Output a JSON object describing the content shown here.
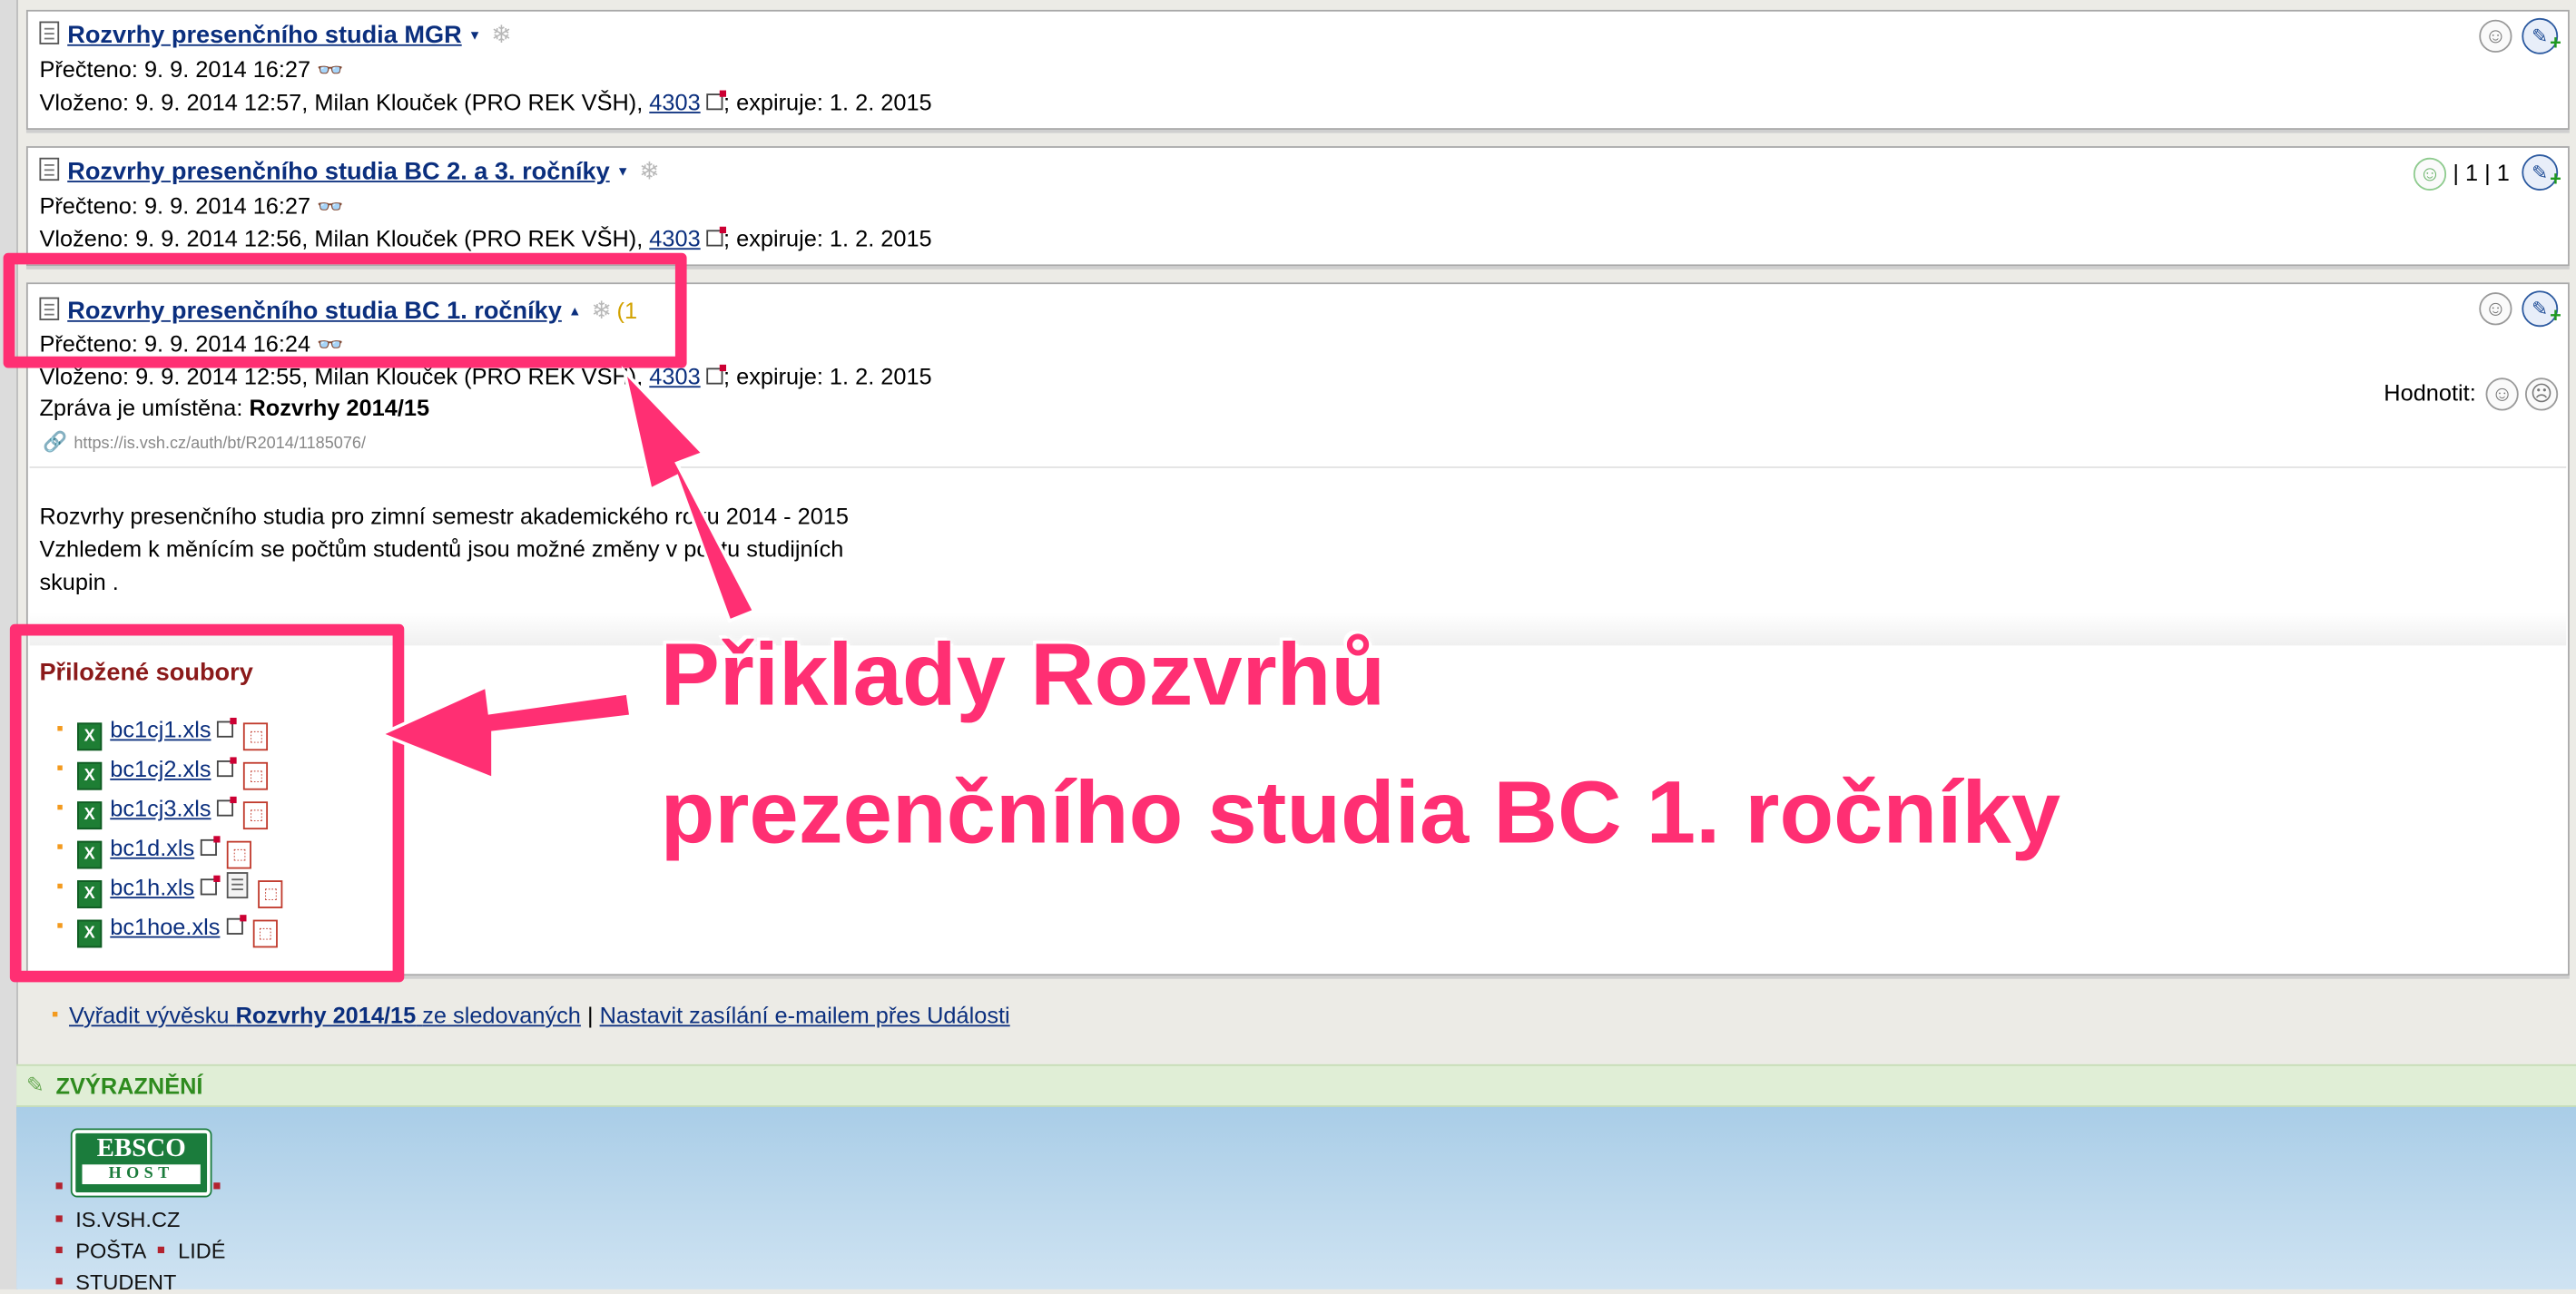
{
  "posts": [
    {
      "title": "Rozvrhy presenčního studia MGR",
      "read_line": "Přečteno: 9. 9. 2014 16:27",
      "inserted_prefix": "Vloženo: 9. 9. 2014 12:57, Milan Klouček (PRO REK VŠH),",
      "user_id": "4303",
      "inserted_suffix": "; expiruje: 1. 2. 2015"
    },
    {
      "title": "Rozvrhy presenčního studia BC 2. a 3. ročníky",
      "read_line": "Přečteno: 9. 9. 2014 16:27",
      "inserted_prefix": "Vloženo: 9. 9. 2014 12:56, Milan Klouček (PRO REK VŠH),",
      "user_id": "4303",
      "inserted_suffix": "; expiruje: 1. 2. 2015",
      "counts": "| 1 | 1"
    },
    {
      "title": "Rozvrhy presenčního studia BC 1. ročníky",
      "badge_partial": "(1",
      "read_line": "Přečteno: 9. 9. 2014 16:24",
      "inserted_prefix": "Vloženo: 9. 9. 2014 12:55, Milan Klouček (PRO REK VŠH),",
      "user_id": "4303",
      "inserted_suffix": "; expiruje: 1. 2. 2015",
      "location_label": "Zpráva je umístěna:",
      "location_value": "Rozvrhy 2014/15",
      "rate_label": "Hodnotit:",
      "url": "https://is.vsh.cz/auth/bt/R2014/1185076/",
      "body_lines": [
        "Rozvrhy presenčního studia pro zimní semestr akademického roku 2014 - 2015",
        "Vzhledem k měnícím se počtům studentů jsou možné změny v počtu studijních",
        "skupin ."
      ],
      "attachments_title": "Přiložené soubory",
      "attachments": [
        "bc1cj1.xls",
        "bc1cj2.xls",
        "bc1cj3.xls",
        "bc1d.xls",
        "bc1h.xls",
        "bc1hoe.xls"
      ]
    }
  ],
  "footer": {
    "unfollow_prefix": "Vyřadit vývěsku",
    "unfollow_board": "Rozvrhy 2014/15",
    "unfollow_suffix": "ze sledovaných",
    "separator": "|",
    "email_link": "Nastavit zasílání e-mailem přes Události"
  },
  "highlight_section": {
    "label": "ZVÝRAZNĚNÍ"
  },
  "portal": {
    "ebsco_top": "EBSCO",
    "ebsco_bottom": "HOST",
    "links": [
      "IS.VSH.CZ",
      "POŠTA",
      "LIDÉ",
      "STUDENT"
    ]
  },
  "annotation": {
    "line1": "Přiklady Rozvrhů",
    "line2": "prezenčního studia BC 1. ročníky"
  },
  "colors": {
    "annotation_pink": "#ff2f73",
    "link_blue": "#0b2f7e",
    "attach_title_red": "#8b1a1a"
  }
}
